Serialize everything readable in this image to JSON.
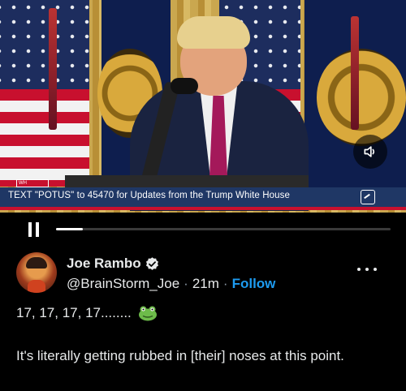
{
  "video": {
    "caption_logo": "WH",
    "caption_text": "TEXT \"POTUS\" to 45470 for Updates from the Trump White House",
    "progress_fraction": 0.08
  },
  "tweet": {
    "display_name": "Joe Rambo",
    "handle": "@BrainStorm_Joe",
    "separator": "·",
    "time": "21m",
    "follow_label": "Follow",
    "line1": "17, 17, 17, 17........",
    "line1_emoji": "frog-icon",
    "line2": "It's literally getting rubbed in [their] noses at this point."
  },
  "colors": {
    "accent": "#1d9bf0",
    "background": "#000000",
    "text": "#e7e9ea",
    "caption_bar": "#1f3765",
    "caption_stripe": "#c8102e"
  }
}
